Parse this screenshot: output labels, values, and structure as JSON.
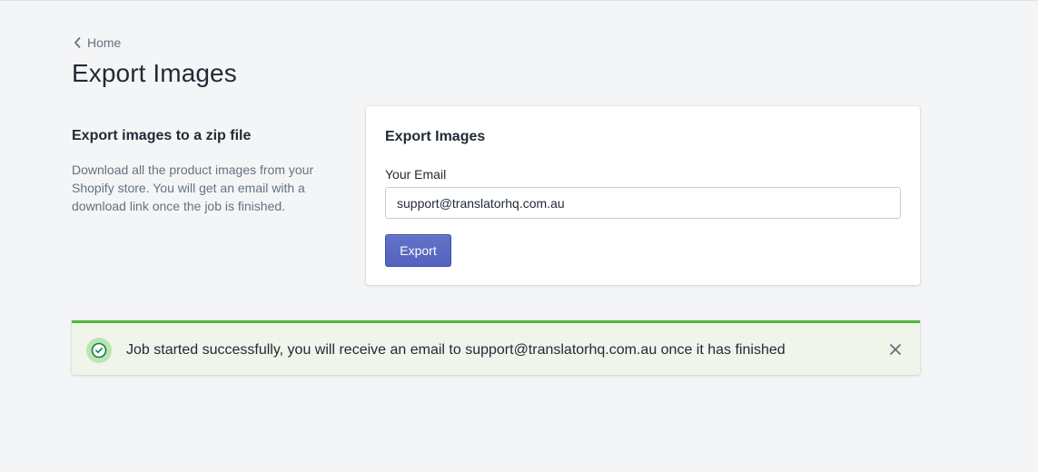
{
  "breadcrumb": {
    "label": "Home",
    "icon": "chevron-left-icon"
  },
  "page": {
    "title": "Export Images"
  },
  "section": {
    "heading": "Export images to a zip file",
    "description": "Download all the product images from your Shopify store. You will get an email with a download link once the job is finished."
  },
  "card": {
    "title": "Export Images",
    "email_label": "Your Email",
    "email_value": "support@translatorhq.com.au",
    "export_button_label": "Export"
  },
  "banner": {
    "status": "success",
    "icon": "checkmark-circle-icon",
    "message": "Job started successfully, you will receive an email to support@translatorhq.com.au once it has finished",
    "close_icon": "close-icon"
  },
  "colors": {
    "primary": "#5c6ac4",
    "success": "#50b83c",
    "banner_bg": "#eff5ea",
    "text": "#212b36",
    "subdued_text": "#637381"
  }
}
